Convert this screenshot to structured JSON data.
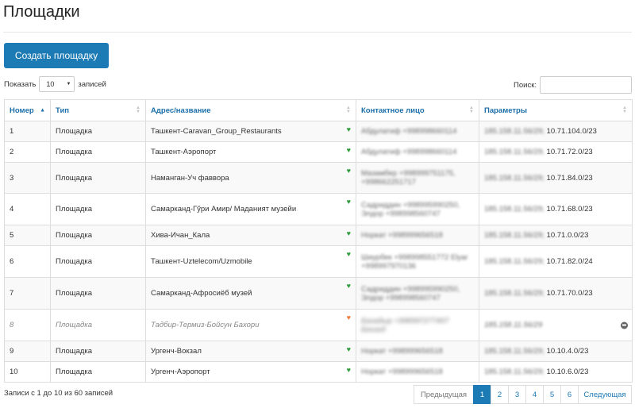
{
  "page": {
    "title": "Площадки"
  },
  "toolbar": {
    "create_label": "Создать площадку"
  },
  "length": {
    "label_before": "Показать",
    "selected": "10",
    "label_after": "записей"
  },
  "search": {
    "label": "Поиск:"
  },
  "table": {
    "columns": [
      "Номер",
      "Тип",
      "Адрес/название",
      "Контактное лицо",
      "Параметры"
    ],
    "rows": [
      {
        "num": "1",
        "type": "Площадка",
        "address": "Ташкент-Caravan_Group_Restaurants",
        "contact": "Абдулатиф +998998660114",
        "params_ip": "185.158.11.56/29;",
        "params_net": "10.71.104.0/23"
      },
      {
        "num": "2",
        "type": "Площадка",
        "address": "Ташкент-Аэропорт",
        "contact": "Абдулатиф +998998660114",
        "params_ip": "185.158.11.56/29;",
        "params_net": "10.71.72.0/23"
      },
      {
        "num": "3",
        "type": "Площадка",
        "address": "Наманган-Уч фаввора",
        "contact": "Мазамбер +998999751175, +998662251717",
        "params_ip": "185.158.11.56/29;",
        "params_net": "10.71.84.0/23"
      },
      {
        "num": "4",
        "type": "Площадка",
        "address": "Самарканд-Гўри Амир/ Маданият музейи",
        "contact": "Садриддин +998995990250, Элдор +998998560747",
        "params_ip": "185.158.11.56/29;",
        "params_net": "10.71.68.0/23"
      },
      {
        "num": "5",
        "type": "Площадка",
        "address": "Хива-Ичан_Кала",
        "contact": "Норкат +998999656518",
        "params_ip": "185.158.11.56/29;",
        "params_net": "10.71.0.0/23"
      },
      {
        "num": "6",
        "type": "Площадка",
        "address": "Ташкент-Uztelecom/Uzmobile",
        "contact": "Шиурбек +998998551772 Elyar +998997970136",
        "params_ip": "185.158.11.56/29;",
        "params_net": "10.71.82.0/24"
      },
      {
        "num": "7",
        "type": "Площадка",
        "address": "Самарканд-Афросиёб музей",
        "contact": "Садриддин +998995990250, Элдор +998998560747",
        "params_ip": "185.158.11.56/29;",
        "params_net": "10.71.70.0/23"
      },
      {
        "num": "8",
        "type": "Площадка",
        "address": "Тадбир-Термиз-Бойсун Бахори",
        "contact": "Бахадыр +998997277407 Бекзод",
        "params_ip": "185.158.11.56/29",
        "params_net": ""
      },
      {
        "num": "9",
        "type": "Площадка",
        "address": "Ургенч-Вокзал",
        "contact": "Норкат +998999656518",
        "params_ip": "185.158.11.56/29;",
        "params_net": "10.10.4.0/23"
      },
      {
        "num": "10",
        "type": "Площадка",
        "address": "Ургенч-Аэропорт",
        "contact": "Норкат +998999656518",
        "params_ip": "185.158.11.56/29;",
        "params_net": "10.10.6.0/23"
      }
    ]
  },
  "footer": {
    "info": "Записи с 1 до 10 из 60 записей"
  },
  "pagination": {
    "prev": "Предыдущая",
    "pages": [
      "1",
      "2",
      "3",
      "4",
      "5",
      "6"
    ],
    "next": "Следующая"
  },
  "colors": {
    "accent": "#1c7ab5",
    "status_ok": "#2f9d3c",
    "status_warn": "#f07b3a"
  },
  "icons": {
    "status_ok": "heart-pulse-icon",
    "status_warn": "heart-pulse-warning-icon",
    "remove": "minus-circle-icon"
  }
}
